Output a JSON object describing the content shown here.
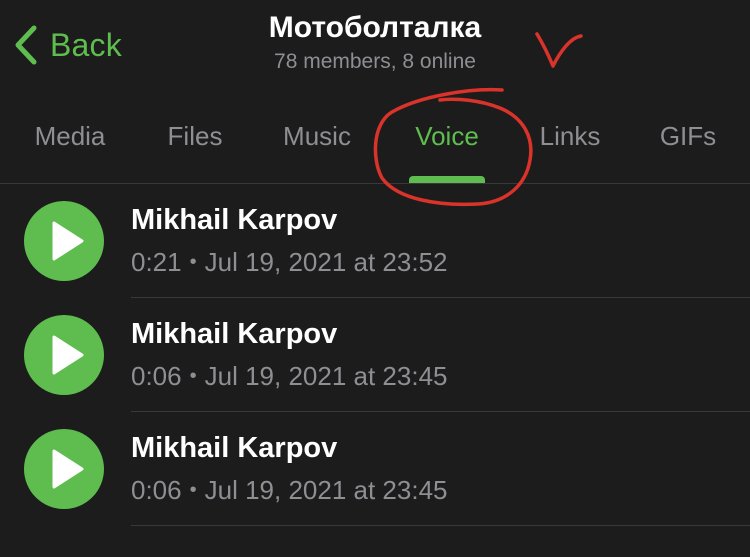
{
  "header": {
    "back_label": "Back",
    "title": "Мотоболталка",
    "subtitle": "78 members, 8 online"
  },
  "tabs": [
    {
      "label": "Media",
      "active": false
    },
    {
      "label": "Files",
      "active": false
    },
    {
      "label": "Music",
      "active": false
    },
    {
      "label": "Voice",
      "active": true
    },
    {
      "label": "Links",
      "active": false
    },
    {
      "label": "GIFs",
      "active": false
    }
  ],
  "voice_messages": [
    {
      "sender": "Mikhail Karpov",
      "duration": "0:21",
      "date": "Jul 19, 2021 at 23:52"
    },
    {
      "sender": "Mikhail Karpov",
      "duration": "0:06",
      "date": "Jul 19, 2021 at 23:45"
    },
    {
      "sender": "Mikhail Karpov",
      "duration": "0:06",
      "date": "Jul 19, 2021 at 23:45"
    }
  ],
  "separator": "•",
  "icons": {
    "back": "chevron-left-icon",
    "play": "play-icon"
  },
  "colors": {
    "accent": "#5fbd4f",
    "background": "#1c1c1d",
    "secondary_text": "#8e8e93",
    "annotation": "#d9332a"
  }
}
